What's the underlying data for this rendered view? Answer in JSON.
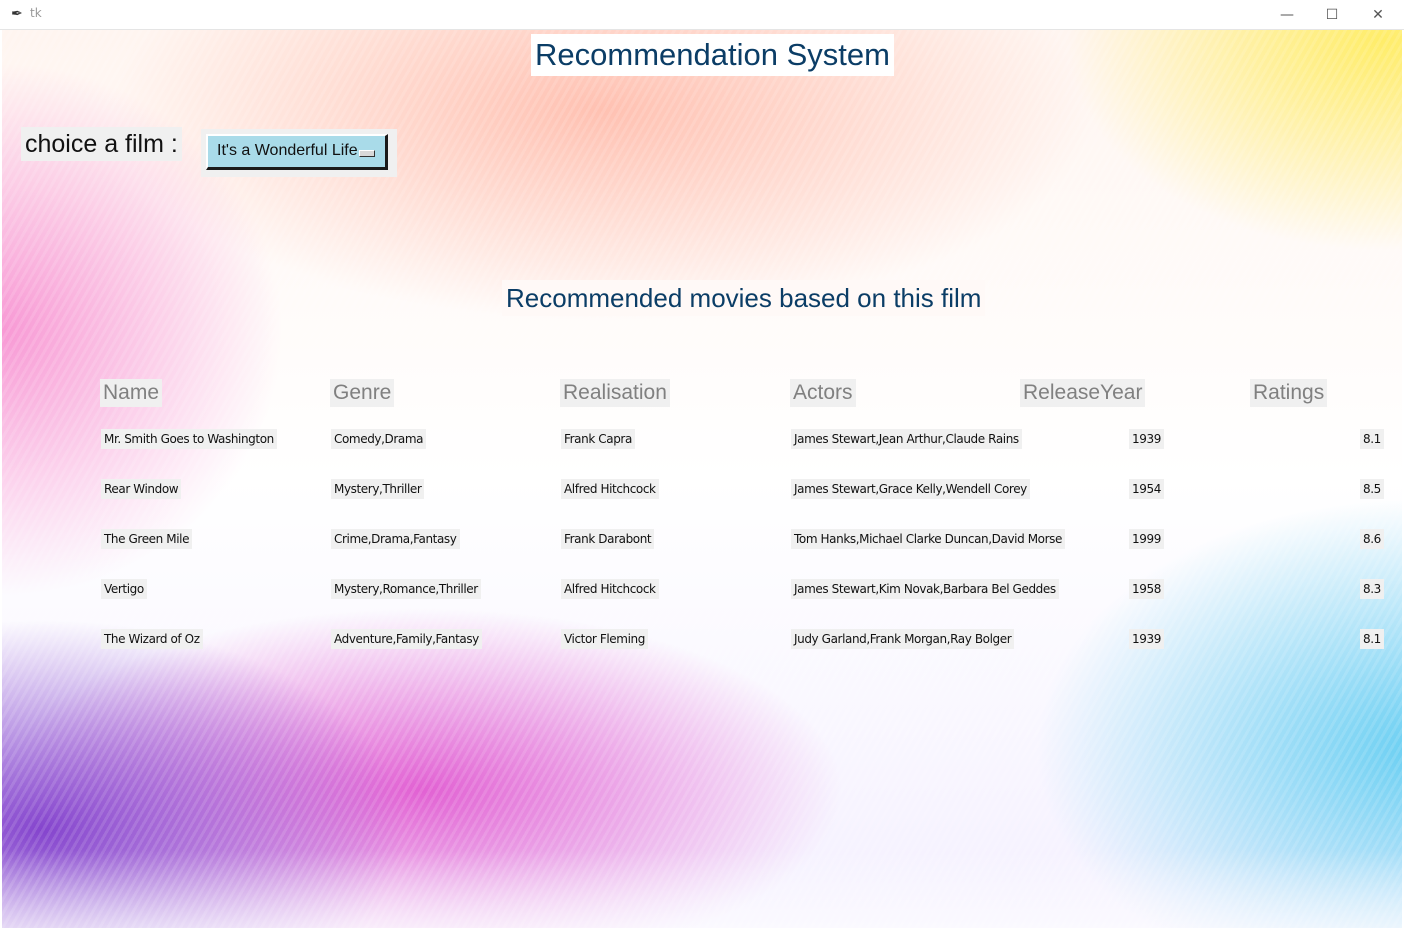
{
  "window": {
    "title": "tk",
    "minimize": "—",
    "maximize": "☐",
    "close": "✕"
  },
  "header": {
    "title": "Recommendation System"
  },
  "chooser": {
    "label": "choice a film :",
    "selected": "It's a Wonderful Life"
  },
  "results": {
    "title": "Recommended movies based on this film",
    "columns": [
      "Name",
      "Genre",
      "Realisation",
      "Actors",
      "ReleaseYear",
      "Ratings"
    ],
    "rows": [
      {
        "name": "Mr. Smith Goes to Washington",
        "genre": "Comedy,Drama",
        "director": "Frank Capra",
        "actors": "James Stewart,Jean Arthur,Claude Rains",
        "year": "1939",
        "rating": "8.1"
      },
      {
        "name": "Rear Window",
        "genre": "Mystery,Thriller",
        "director": "Alfred Hitchcock",
        "actors": "James Stewart,Grace Kelly,Wendell Corey",
        "year": "1954",
        "rating": "8.5"
      },
      {
        "name": "The Green Mile",
        "genre": "Crime,Drama,Fantasy",
        "director": "Frank Darabont",
        "actors": "Tom Hanks,Michael Clarke Duncan,David Morse",
        "year": "1999",
        "rating": "8.6"
      },
      {
        "name": "Vertigo",
        "genre": "Mystery,Romance,Thriller",
        "director": "Alfred Hitchcock",
        "actors": "James Stewart,Kim Novak,Barbara Bel Geddes",
        "year": "1958",
        "rating": "8.3"
      },
      {
        "name": "The Wizard of Oz",
        "genre": "Adventure,Family,Fantasy",
        "director": "Victor Fleming",
        "actors": "Judy Garland,Frank Morgan,Ray Bolger",
        "year": "1939",
        "rating": "8.1"
      }
    ]
  }
}
